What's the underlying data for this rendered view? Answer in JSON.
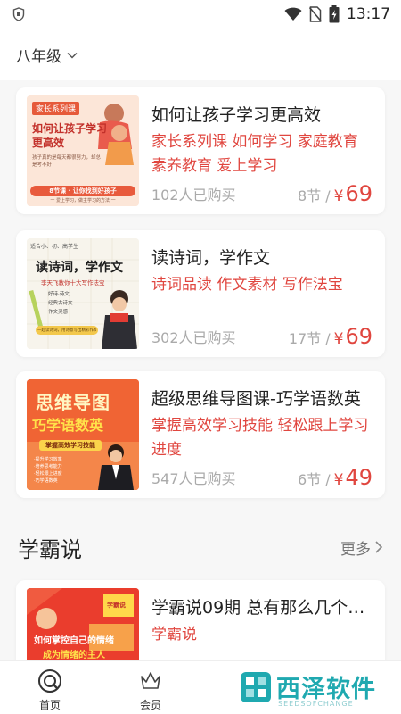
{
  "status_bar": {
    "time": "13:17",
    "icons": [
      "shield-icon",
      "wifi-icon",
      "no-sim-icon",
      "battery-charging-icon"
    ]
  },
  "grade_selector": {
    "label": "八年级",
    "icon": "chevron-down-icon"
  },
  "courses": [
    {
      "title": "如何让孩子学习更高效",
      "tags": "家长系列课 如何学习 家庭教育 素养教育 爱上学习",
      "bought": "102人已购买",
      "lessons": "8节",
      "price_symbol": "¥",
      "price": "69",
      "thumb": {
        "badge": "家长系列课",
        "headline1": "如何让孩子学习",
        "headline2": "更高效",
        "desc": "孩子真的是每天都很努力，却总是考不好",
        "pill": "8节课 · 让你找到好孩子",
        "footer": "一 爱上学习，做主学习的方法 一"
      }
    },
    {
      "title": "读诗词，学作文",
      "tags": "诗词品读 作文素材 写作法宝",
      "bought": "302人已购买",
      "lessons": "17节",
      "price_symbol": "¥",
      "price": "69",
      "thumb": {
        "corner": "适合小、初、高学生",
        "headline": "读诗词，学作文",
        "sub": "李天飞教你十大写作法宝",
        "tag1": "好诗·诗文",
        "tag2": "经典古诗文",
        "tag3": "作文灵感",
        "footer": "一起读诗词，用诗意写出精彩作文"
      }
    },
    {
      "title": "超级思维导图课-巧学语数英",
      "tags": "掌握高效学习技能 轻松跟上学习进度",
      "bought": "547人已购买",
      "lessons": "6节",
      "price_symbol": "¥",
      "price": "49",
      "thumb": {
        "headline1": "思维导图",
        "headline2": "巧学语数英",
        "ribbon": "掌握高效学习技能",
        "bullet1": "·提升学习效率",
        "bullet2": "·培养思考能力",
        "bullet3": "·轻松跟上进度",
        "bullet4": "·巧学语数英"
      }
    }
  ],
  "section": {
    "title": "学霸说",
    "more": "更多"
  },
  "xuebashuo": {
    "title": "学霸说09期 总有那么几个…",
    "tag": "学霸说",
    "thumb": {
      "badge": "学霸说",
      "headline1": "如何掌控自己的情绪",
      "headline2": "成为情绪的主人"
    }
  },
  "bottom_nav": [
    {
      "label": "首页",
      "icon": "home-icon"
    },
    {
      "label": "会员",
      "icon": "crown-icon"
    }
  ],
  "watermark": {
    "text": "西泽软件",
    "sub": "SEEDSOFCHANGE"
  },
  "colors": {
    "accent_red": "#e0463f",
    "muted": "#aaaaaa",
    "watermark_teal": "#1fa9b0"
  }
}
